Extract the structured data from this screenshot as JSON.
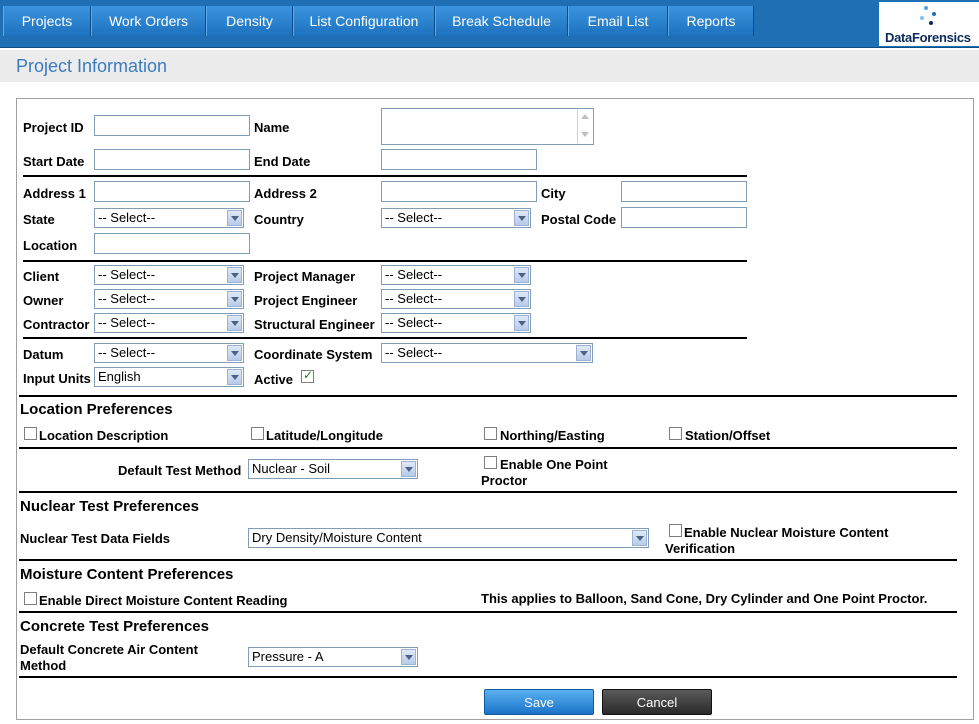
{
  "nav": {
    "items": [
      {
        "label": "Projects"
      },
      {
        "label": "Work Orders"
      },
      {
        "label": "Density"
      },
      {
        "label": "List Configuration"
      },
      {
        "label": "Break Schedule"
      },
      {
        "label": "Email List"
      },
      {
        "label": "Reports"
      }
    ],
    "logo_text": "DataForensics"
  },
  "page": {
    "title": "Project Information"
  },
  "form": {
    "project_id_label": "Project ID",
    "name_label": "Name",
    "start_date_label": "Start Date",
    "end_date_label": "End Date",
    "address1_label": "Address 1",
    "address2_label": "Address 2",
    "city_label": "City",
    "state_label": "State",
    "state_value": "-- Select--",
    "country_label": "Country",
    "country_value": "-- Select--",
    "postal_label": "Postal Code",
    "location_label": "Location",
    "client_label": "Client",
    "client_value": "-- Select--",
    "pm_label": "Project Manager",
    "pm_value": "-- Select--",
    "owner_label": "Owner",
    "owner_value": "-- Select--",
    "pe_label": "Project Engineer",
    "pe_value": "-- Select--",
    "contractor_label": "Contractor",
    "contractor_value": "-- Select--",
    "se_label": "Structural Engineer",
    "se_value": "-- Select--",
    "datum_label": "Datum",
    "datum_value": "-- Select--",
    "coord_label": "Coordinate System",
    "coord_value": "-- Select--",
    "units_label": "Input Units",
    "units_value": "English",
    "active_label": "Active",
    "active_checked": true
  },
  "location_prefs": {
    "title": "Location Preferences",
    "options": [
      "Location Description",
      "Latitude/Longitude",
      "Northing/Easting",
      "Station/Offset"
    ],
    "default_test_label": "Default Test Method",
    "default_test_value": "Nuclear - Soil",
    "one_point_label_1": "Enable One Point",
    "one_point_label_2": "Proctor"
  },
  "nuclear_prefs": {
    "title": "Nuclear Test Preferences",
    "fields_label": "Nuclear Test Data Fields",
    "fields_value": "Dry Density/Moisture Content",
    "verify_label_1": "Enable Nuclear Moisture Content",
    "verify_label_2": "Verification"
  },
  "moisture_prefs": {
    "title": "Moisture Content Preferences",
    "direct_label": "Enable Direct Moisture Content Reading",
    "note": "This applies to Balloon, Sand Cone, Dry Cylinder and One Point Proctor."
  },
  "concrete_prefs": {
    "title": "Concrete Test Preferences",
    "air_label_1": "Default Concrete Air Content",
    "air_label_2": "Method",
    "air_value": "Pressure - A"
  },
  "actions": {
    "save": "Save",
    "cancel": "Cancel"
  }
}
